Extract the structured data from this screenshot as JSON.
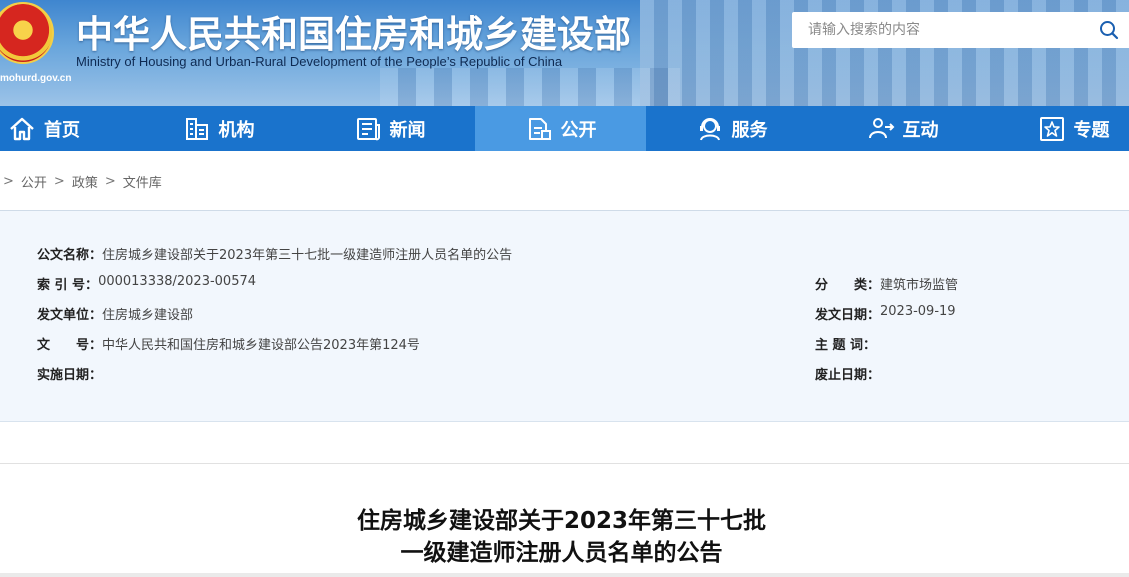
{
  "header": {
    "title_cn": "中华人民共和国住房和城乡建设部",
    "title_en": "Ministry of Housing and Urban-Rural Development of the People’s Republic of China",
    "domain": "mohurd.gov.cn",
    "search_placeholder": "请输入搜索的内容"
  },
  "nav": {
    "items": [
      {
        "label": "首页",
        "icon": "home-icon"
      },
      {
        "label": "机构",
        "icon": "building-icon"
      },
      {
        "label": "新闻",
        "icon": "news-icon"
      },
      {
        "label": "公开",
        "icon": "document-icon"
      },
      {
        "label": "服务",
        "icon": "service-icon"
      },
      {
        "label": "互动",
        "icon": "interact-icon"
      },
      {
        "label": "专题",
        "icon": "star-icon"
      }
    ],
    "active_index": 3
  },
  "breadcrumb": {
    "items": [
      "公开",
      "政策",
      "文件库"
    ],
    "separator": ">"
  },
  "meta": {
    "doc_name_label": "公文名称：",
    "doc_name": "住房城乡建设部关于2023年第三十七批一级建造师注册人员名单的公告",
    "index_label": "索 引 号：",
    "index": "000013338/2023-00574",
    "category_label": "分　　类：",
    "category": "建筑市场监管",
    "issuer_label": "发文单位：",
    "issuer": "住房城乡建设部",
    "issue_date_label": "发文日期：",
    "issue_date": "2023-09-19",
    "doc_no_label": "文　　号：",
    "doc_no": "中华人民共和国住房和城乡建设部公告2023年第124号",
    "keywords_label": "主 题 词：",
    "keywords": "",
    "effective_label": "实施日期：",
    "effective": "",
    "expire_label": "废止日期：",
    "expire": ""
  },
  "article": {
    "title_line1": "住房城乡建设部关于2023年第三十七批",
    "title_line2": "一级建造师注册人员名单的公告"
  },
  "colors": {
    "nav_bg": "#1a73cc",
    "nav_active": "#4a9ae3",
    "meta_bg": "#f2f7fd"
  }
}
